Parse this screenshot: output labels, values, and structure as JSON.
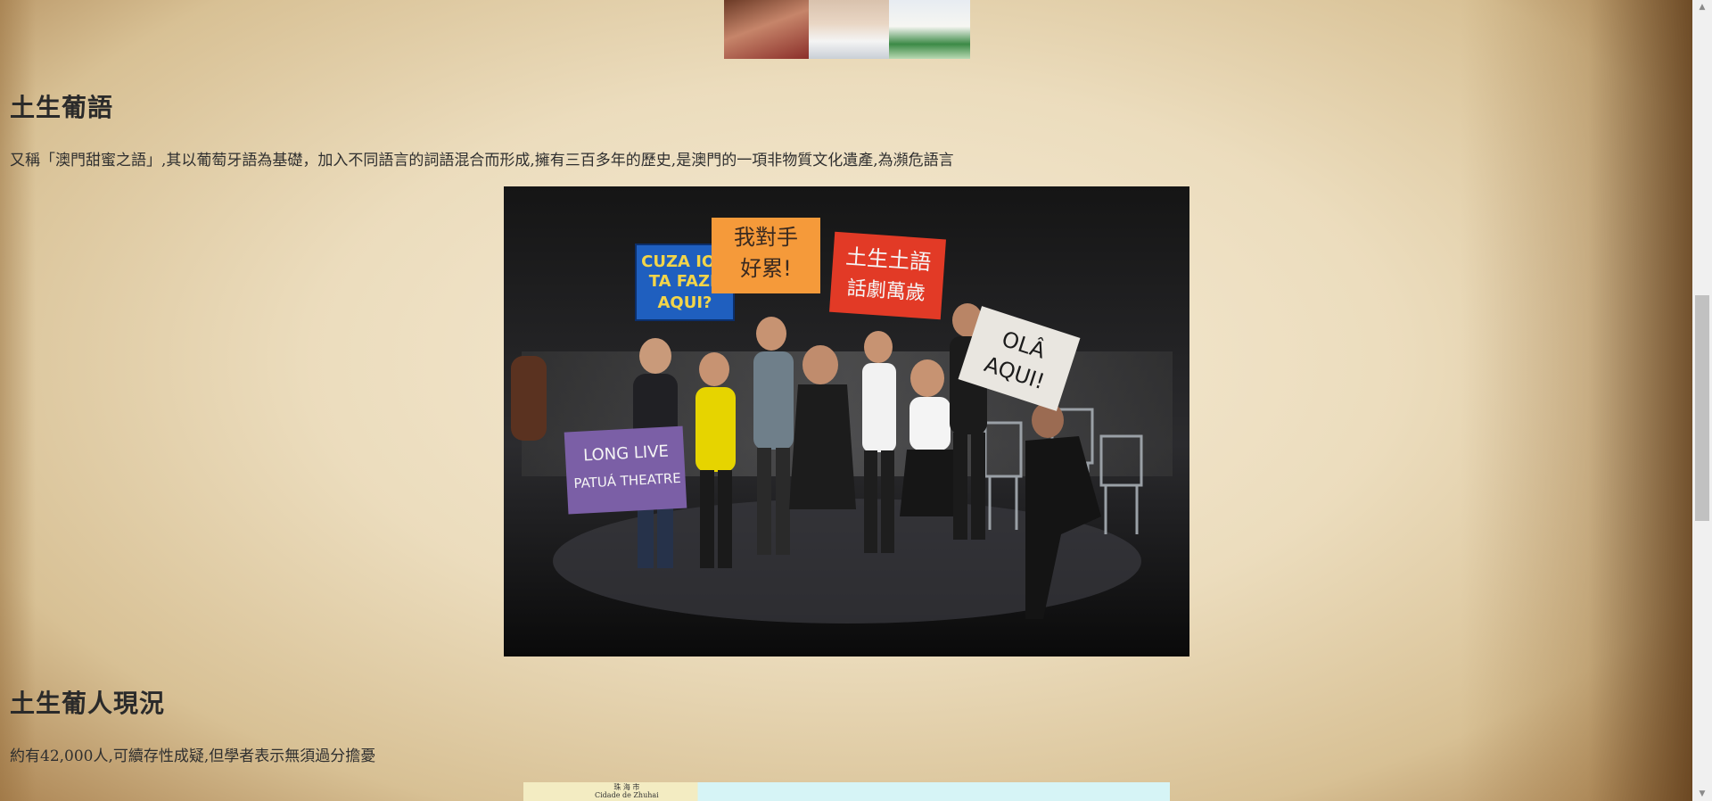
{
  "top_strip": {
    "images": [
      {
        "name": "portrait-woman-traditional"
      },
      {
        "name": "portrait-racing-driver"
      },
      {
        "name": "portrait-athlete-medal"
      }
    ]
  },
  "sections": {
    "patua": {
      "heading": "土生葡語",
      "body": "又稱「澳門甜蜜之語」,其以葡萄牙語為基礎，加入不同語言的詞語混合而形成,擁有三百多年的歷史,是澳門的一項非物質文化遺產,為瀕危語言"
    },
    "status": {
      "heading": "土生葡人現況",
      "body": "約有42,000人,可續存性成疑,但學者表示無須過分擔憂"
    }
  },
  "photo": {
    "signs": {
      "blue": [
        "CUZA IOU",
        "TA FAZE",
        "AQUI?"
      ],
      "orange": [
        "我對手",
        "好累!"
      ],
      "red": [
        "土生土語",
        "話劇萬歲"
      ],
      "white": [
        "OLÂ",
        "AQUI!"
      ],
      "purple": [
        "LONG LIVE",
        "PATUÁ THEATRE"
      ]
    },
    "colors": {
      "blue": "#1f5fbf",
      "orange": "#f59a3a",
      "red": "#e23a26",
      "white": "#e9e6e0",
      "purple": "#7b5fa6"
    }
  },
  "map": {
    "label_line1": "珠 海 市",
    "label_line2": "Cidade de Zhuhai"
  },
  "scrollbar": {
    "up_icon": "▲",
    "down_icon": "▼"
  }
}
